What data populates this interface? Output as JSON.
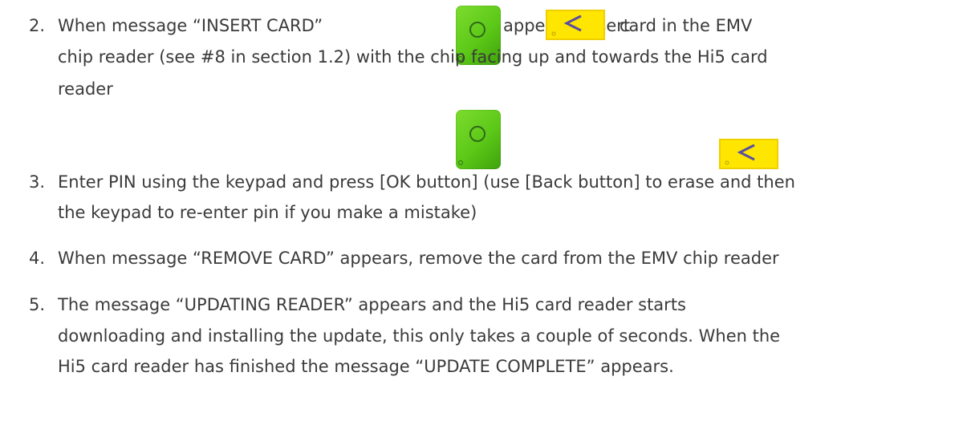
{
  "steps": [
    {
      "number": "2.",
      "lines": [
        "When message “INSERT CARD”",
        "appears, insert",
        "card in the EMV",
        "chip reader (see #8 in section 1.2)  with the chip facing up and towards the Hi5 card",
        "reader"
      ]
    },
    {
      "number": "3.",
      "lines": [
        "Enter PIN using the keypad and press  [OK button] (use [Back button] to erase and then",
        "the keypad to re-enter pin if you make a mistake)"
      ]
    },
    {
      "number": "4.",
      "lines": [
        "When message “REMOVE CARD” appears, remove the card from the EMV chip reader"
      ]
    },
    {
      "number": "5.",
      "lines": [
        "The message “UPDATING READER” appears and the Hi5 card reader starts",
        "downloading and installing the update, this only takes a couple of seconds. When the",
        "Hi5 card reader has finished the message “UPDATE COMPLETE” appears."
      ]
    }
  ],
  "icons": {
    "ok": "ok-button-icon",
    "back": "back-button-icon"
  },
  "colors": {
    "ok_green": "#5cc817",
    "back_yellow": "#ffe600",
    "text": "#3a3a3a"
  }
}
